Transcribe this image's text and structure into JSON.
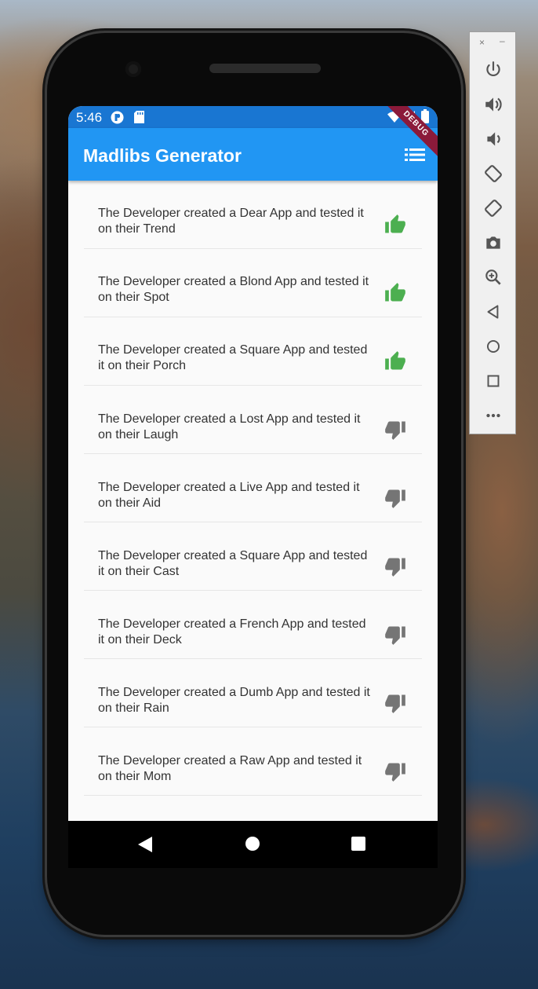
{
  "status_bar": {
    "time": "5:46"
  },
  "app_bar": {
    "title": "Madlibs Generator",
    "debug_label": "DEBUG"
  },
  "colors": {
    "status_bar": "#1976D2",
    "app_bar": "#2196F3",
    "thumb_up": "#4CAF50",
    "thumb_down": "#757575"
  },
  "items": [
    {
      "text": "The Developer created a Dear App and tested it on their Trend",
      "rating": "thumb-up"
    },
    {
      "text": "The Developer created a Blond App and tested it on their Spot",
      "rating": "thumb-up"
    },
    {
      "text": "The Developer created a Square App and tested it on their Porch",
      "rating": "thumb-up"
    },
    {
      "text": "The Developer created a Lost App and tested it on their Laugh",
      "rating": "thumb-down"
    },
    {
      "text": "The Developer created a Live App and tested it on their Aid",
      "rating": "thumb-down"
    },
    {
      "text": "The Developer created a Square App and tested it on their Cast",
      "rating": "thumb-down"
    },
    {
      "text": "The Developer created a French App and tested it on their Deck",
      "rating": "thumb-down"
    },
    {
      "text": "The Developer created a Dumb App and tested it on their Rain",
      "rating": "thumb-down"
    },
    {
      "text": "The Developer created a Raw App and tested it on their Mom",
      "rating": "thumb-down"
    }
  ],
  "emulator_panel": {
    "close": "×",
    "minimize": "–"
  }
}
